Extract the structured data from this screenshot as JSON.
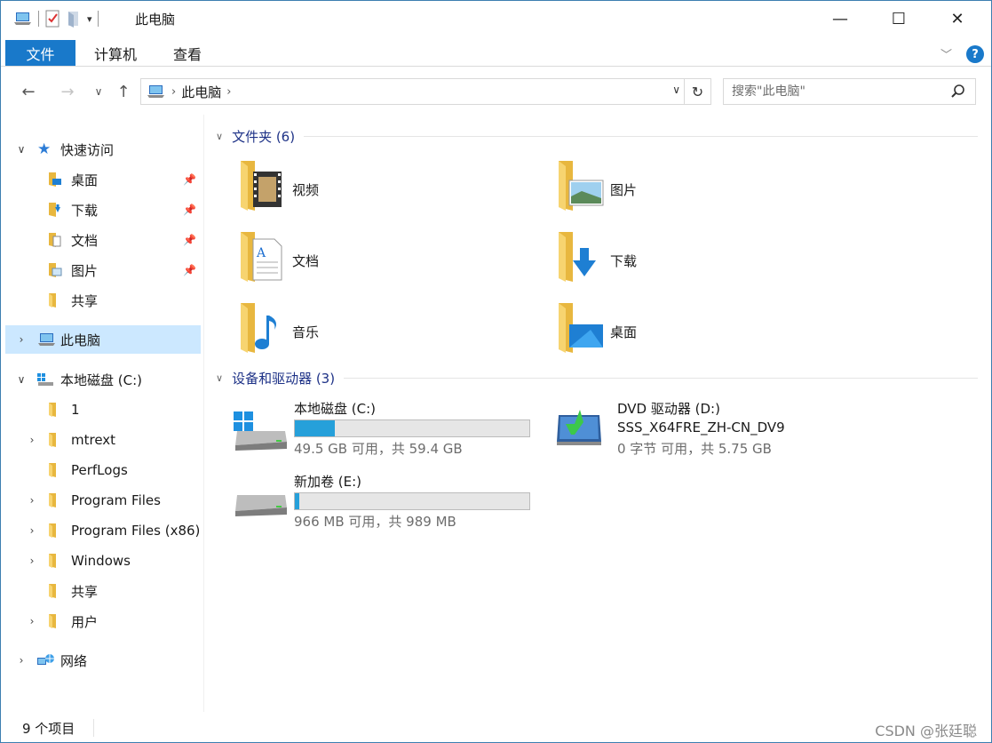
{
  "window": {
    "title": "此电脑"
  },
  "titlebar": {
    "minimize": "—",
    "maximize": "☐",
    "close": "✕"
  },
  "ribbon": {
    "tabs": [
      "文件",
      "计算机",
      "查看"
    ],
    "help": "?"
  },
  "address": {
    "crumb": "此电脑"
  },
  "search": {
    "placeholder": "搜索\"此电脑\""
  },
  "nav": {
    "quick_access": "快速访问",
    "quick_items": [
      "桌面",
      "下载",
      "文档",
      "图片",
      "共享"
    ],
    "this_pc": "此电脑",
    "local_disk": "本地磁盘 (C:)",
    "disk_items": [
      "1",
      "mtrext",
      "PerfLogs",
      "Program Files",
      "Program Files (x86)",
      "Windows",
      "共享",
      "用户"
    ],
    "network": "网络"
  },
  "content": {
    "folders_header": "文件夹 (6)",
    "folders": [
      "视频",
      "图片",
      "文档",
      "下载",
      "音乐",
      "桌面"
    ],
    "devices_header": "设备和驱动器 (3)",
    "drives": [
      {
        "name": "本地磁盘 (C:)",
        "free": "49.5 GB 可用，共 59.4 GB",
        "used_fraction": 0.17
      },
      {
        "name": "DVD 驱动器 (D:)",
        "label": "SSS_X64FRE_ZH-CN_DV9",
        "free": "0 字节 可用，共 5.75 GB"
      },
      {
        "name": "新加卷 (E:)",
        "free": "966 MB 可用，共 989 MB",
        "used_fraction": 0.02
      }
    ]
  },
  "status": {
    "count": "9 个项目"
  },
  "watermark": "CSDN @张廷聪",
  "colors": {
    "accent": "#1979ca",
    "selection": "#cce8ff",
    "drive_bar": "#26a0da"
  }
}
